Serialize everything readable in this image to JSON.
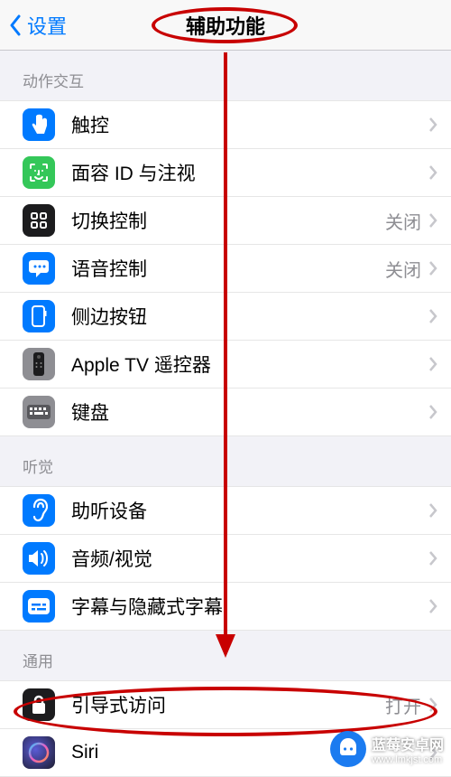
{
  "nav": {
    "back": "设置",
    "title": "辅助功能"
  },
  "sections": [
    {
      "header": "动作交互",
      "items": [
        {
          "label": "触控",
          "value": null
        },
        {
          "label": "面容 ID 与注视",
          "value": null
        },
        {
          "label": "切换控制",
          "value": "关闭"
        },
        {
          "label": "语音控制",
          "value": "关闭"
        },
        {
          "label": "侧边按钮",
          "value": null
        },
        {
          "label": "Apple TV 遥控器",
          "value": null
        },
        {
          "label": "键盘",
          "value": null
        }
      ]
    },
    {
      "header": "听觉",
      "items": [
        {
          "label": "助听设备",
          "value": null
        },
        {
          "label": "音频/视觉",
          "value": null
        },
        {
          "label": "字幕与隐藏式字幕",
          "value": null
        }
      ]
    },
    {
      "header": "通用",
      "items": [
        {
          "label": "引导式访问",
          "value": "打开"
        },
        {
          "label": "Siri",
          "value": null
        }
      ]
    }
  ],
  "watermark": {
    "text": "蓝莓安卓网",
    "url": "www.lmkjst.com"
  }
}
